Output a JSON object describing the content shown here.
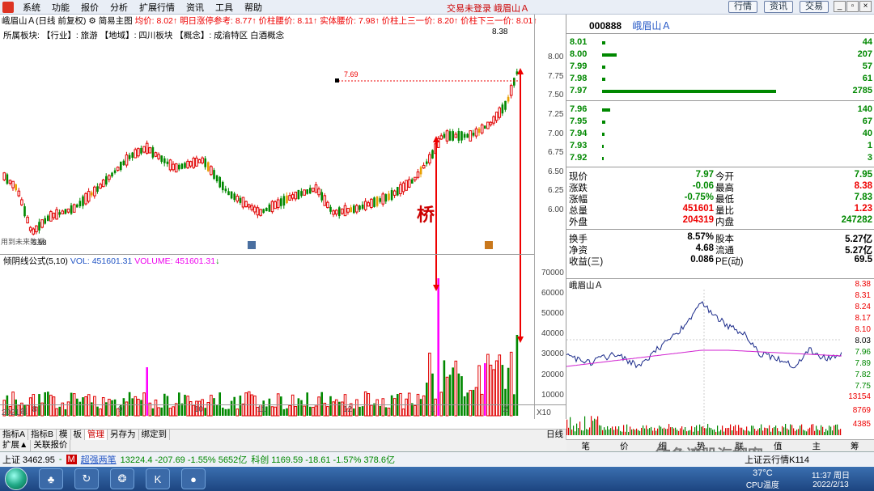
{
  "menubar": {
    "items": [
      "系统",
      "功能",
      "报价",
      "分析",
      "扩展行情",
      "资讯",
      "工具",
      "帮助"
    ],
    "center_text": "交易未登录  峨眉山Ａ",
    "right_buttons": [
      "行情",
      "资讯",
      "交易"
    ]
  },
  "chart_title": {
    "name": "峨眉山Ａ(日线 前复权)",
    "indicator": "简易主图",
    "avg_label": "均价: 8.02",
    "limit_label": "明日涨停参考: 8.77",
    "mid_label": "价柱腰价: 8.11",
    "body_label": "实体腰价: 7.98",
    "upper_label": "价柱上三一价: 8.20",
    "lower_label": "价柱下三一价: 8.01"
  },
  "sector_line": "所属板块:    【行业】: 旅游        【地域】: 四川板块        【概念】: 成渝特区 白酒概念",
  "annotations": {
    "high_label": "8.38",
    "marker_label": "7.69",
    "low_label": "5.58",
    "bridge_char": "桥",
    "bottom_left": "用到未来数据"
  },
  "price_axis": [
    "8.00",
    "7.75",
    "7.50",
    "7.25",
    "7.00",
    "6.75",
    "6.50",
    "6.25",
    "6.00"
  ],
  "volume_title": {
    "name": "倾阴线公式(5,10)",
    "vol": "VOL: 451601.31",
    "volume": "VOLUME: 451601.31"
  },
  "volume_axis": [
    "70000",
    "60000",
    "50000",
    "40000",
    "30000",
    "20000",
    "10000"
  ],
  "volume_unit": "X10",
  "date_axis": [
    "2021年",
    "8",
    "9",
    "10",
    "11",
    "12",
    "1",
    "2"
  ],
  "bottom_tabs": [
    "指标A",
    "指标B",
    "模",
    "板",
    "管理",
    "另存为",
    "绑定到",
    "日线"
  ],
  "bottom_tabs2": [
    "扩展▲",
    "关联报价"
  ],
  "quote": {
    "code": "000888",
    "name": "峨眉山Ａ",
    "orderbook_top": [
      {
        "price": "8.01",
        "vol": "44"
      },
      {
        "price": "8.00",
        "vol": "207"
      },
      {
        "price": "7.99",
        "vol": "57"
      },
      {
        "price": "7.98",
        "vol": "61"
      },
      {
        "price": "7.97",
        "vol": "2785"
      }
    ],
    "orderbook_bottom": [
      {
        "price": "7.96",
        "vol": "140"
      },
      {
        "price": "7.95",
        "vol": "67"
      },
      {
        "price": "7.94",
        "vol": "40"
      },
      {
        "price": "7.93",
        "vol": "1"
      },
      {
        "price": "7.92",
        "vol": "3"
      }
    ],
    "stats1": [
      {
        "l1": "现价",
        "v1": "7.97",
        "l2": "今开",
        "v2": "7.95"
      },
      {
        "l1": "涨跌",
        "v1": "-0.06",
        "l2": "最高",
        "v2": "8.38"
      },
      {
        "l1": "涨幅",
        "v1": "-0.75%",
        "l2": "最低",
        "v2": "7.83"
      },
      {
        "l1": "总量",
        "v1": "451601",
        "l2": "量比",
        "v2": "1.23"
      },
      {
        "l1": "外盘",
        "v1": "204319",
        "l2": "内盘",
        "v2": "247282"
      }
    ],
    "stats2": [
      {
        "l1": "换手",
        "v1": "8.57%",
        "l2": "股本",
        "v2": "5.27亿"
      },
      {
        "l1": "净资",
        "v1": "4.68",
        "l2": "流通",
        "v2": "5.27亿"
      },
      {
        "l1": "收益(三)",
        "v1": "0.086",
        "l2": "PE(动)",
        "v2": "69.5"
      }
    ]
  },
  "minichart": {
    "title": "峨眉山Ａ",
    "price_labels": [
      "8.38",
      "8.31",
      "8.24",
      "8.17",
      "8.10",
      "8.03",
      "7.96",
      "7.89",
      "7.82",
      "7.75"
    ],
    "vol_labels": [
      "13154",
      "8769",
      "4385"
    ],
    "bottom_tabs": [
      "笔",
      "价",
      "细",
      "势",
      "联",
      "值",
      "主",
      "筹"
    ]
  },
  "statusbar": {
    "sh": "上证 3462.95",
    "sh_chg": "-",
    "brand": "超强两笔",
    "sz": "13224.4 -207.69 -1.55% 5652亿",
    "cy": "科创 1169.59 -18.61 -1.57% 378.6亿",
    "right": "上证云行情K114"
  },
  "taskbar": {
    "temp": "37°C",
    "cpu": "CPU温度",
    "time": "11:37 周日",
    "date": "2022/2/13"
  },
  "watermark": "钓鱼湾股海探密",
  "colors": {
    "up": "#e00000",
    "down": "#008800",
    "volspike": "#ff00ff",
    "gold": "#e8a000"
  }
}
